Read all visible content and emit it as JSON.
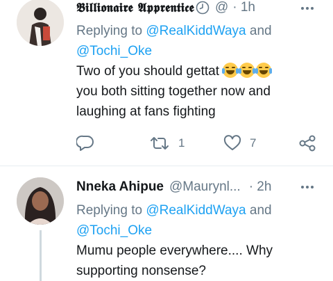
{
  "tweets": [
    {
      "name": "𝕭𝖎𝖑𝖑𝖎𝖔𝖓𝖆𝖎𝖗𝖊 𝕬𝖕𝖕𝖗𝖊𝖓𝖙𝖎𝖈𝖊",
      "handle": "@",
      "time": "· 1h",
      "replying_prefix": "Replying to",
      "mention_1": "@RealKiddWaya",
      "replying_and": "and",
      "mention_2": "@Tochi_Oke",
      "text_1": "Two of you should gettat",
      "text_2": "you both sitting together now and laughing at fans fighting",
      "reply_count": "",
      "retweet_count": "1",
      "like_count": "7"
    },
    {
      "name": "Nneka Ahipue",
      "handle": "@Maurynl...",
      "time": "· 2h",
      "replying_prefix": "Replying to",
      "mention_1": "@RealKiddWaya",
      "replying_and": "and",
      "mention_2": "@Tochi_Oke",
      "text": "Mumu people everywhere.... Why supporting nonsense?"
    }
  ],
  "colors": {
    "link": "#1da1f2",
    "secondary_text": "#657786",
    "primary_text": "#14171a",
    "divider": "#e6ecf0"
  },
  "icons": [
    "clock-icon",
    "more-icon",
    "reply-icon",
    "retweet-icon",
    "like-icon",
    "share-icon",
    "emoji-joy-icon"
  ]
}
